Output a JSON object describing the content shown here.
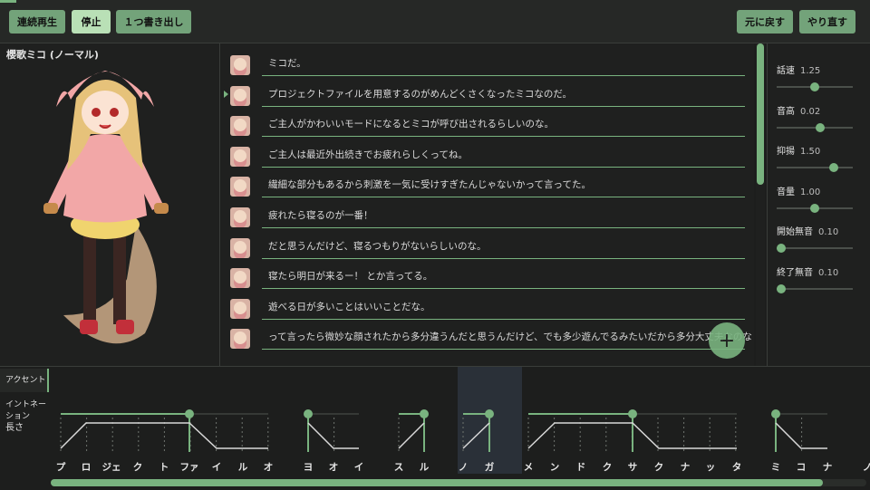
{
  "toolbar": {
    "play_all": "連続再生",
    "stop": "停止",
    "export_one": "１つ書き出し",
    "undo": "元に戻す",
    "redo": "やり直す"
  },
  "character": {
    "name": "櫻歌ミコ (ノーマル)"
  },
  "lines": [
    "ミコだ。",
    "プロジェクトファイルを用意するのがめんどくさくなったミコなのだ。",
    "ご主人がかわいいモードになるとミコが呼び出されるらしいのな。",
    "ご主人は最近外出続きでお疲れらしくってね。",
    "繊細な部分もあるから刺激を一気に受けすぎたんじゃないかって言ってた。",
    "疲れたら寝るのが一番！",
    "だと思うんだけど、寝るつもりがないらしいのな。",
    "寝たら明日が来るー！ とか言ってる。",
    "遊べる日が多いことはいいことだな。",
    "って言ったら微妙な顔されたから多分違うんだと思うんだけど、でも多少遊んでるみたいだから多分大丈夫なのな"
  ],
  "fab": {
    "label": "+"
  },
  "params": [
    {
      "label": "話速",
      "value": "1.25",
      "level": 0.5
    },
    {
      "label": "音高",
      "value": "0.02",
      "level": 0.57
    },
    {
      "label": "抑揚",
      "value": "1.50",
      "level": 0.75
    },
    {
      "label": "音量",
      "value": "1.00",
      "level": 0.5
    },
    {
      "label": "開始無音",
      "value": "0.10",
      "level": 0.06
    },
    {
      "label": "終了無音",
      "value": "0.10",
      "level": 0.06
    }
  ],
  "bottom": {
    "tabs": [
      "アクセント",
      "イントネーション",
      "長さ"
    ],
    "moras": [
      "プ",
      "ロ",
      "ジェ",
      "ク",
      "ト",
      "ファ",
      "イ",
      "ル",
      "オ",
      "ヨ",
      "オ",
      "イ",
      "ス",
      "ル",
      "ノ",
      "ガ",
      "メ",
      "ン",
      "ド",
      "ク",
      "サ",
      "ク",
      "ナ",
      "ッ",
      "タ",
      "ミ",
      "コ",
      "ナ",
      "ノ"
    ]
  },
  "colors": {
    "accent": "#79b37f",
    "accent_light": "#b9e0b6",
    "bg": "#1d1e1d"
  }
}
